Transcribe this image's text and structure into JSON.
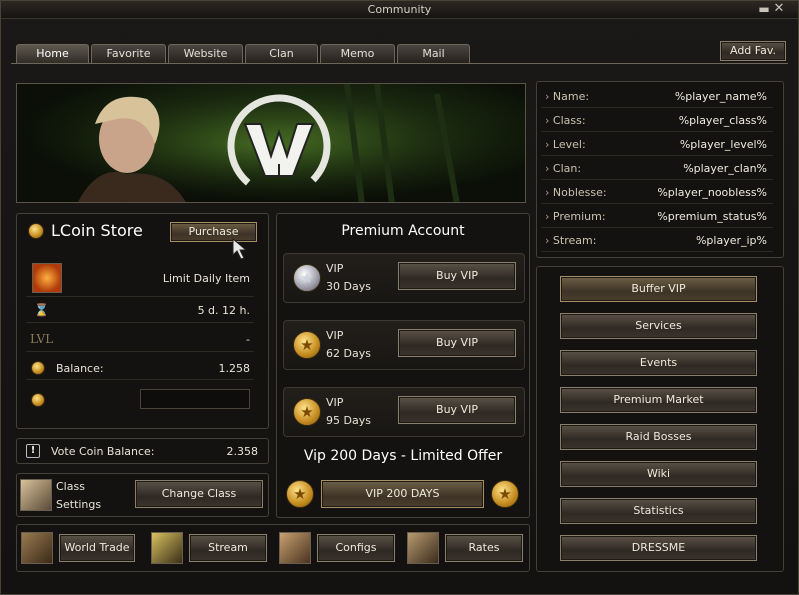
{
  "window": {
    "title": "Community"
  },
  "tabs": [
    "Home",
    "Favorite",
    "Website",
    "Clan",
    "Memo",
    "Mail"
  ],
  "add_fav_label": "Add Fav.",
  "player_info": [
    {
      "label": "Name:",
      "value": "%player_name%"
    },
    {
      "label": "Class:",
      "value": "%player_class%"
    },
    {
      "label": "Level:",
      "value": "%player_level%"
    },
    {
      "label": "Clan:",
      "value": "%player_clan%"
    },
    {
      "label": "Noblesse:",
      "value": "%player_noobless%"
    },
    {
      "label": "Premium:",
      "value": "%premium_status%"
    },
    {
      "label": "Stream:",
      "value": "%player_ip%"
    }
  ],
  "lcoin_store": {
    "title": "LCoin Store",
    "purchase_label": "Purchase",
    "item_name": "Limit Daily Item",
    "time_left": "5 d. 12 h.",
    "level_label": "LVL",
    "level_value": "-",
    "balance_label": "Balance:",
    "balance_value": "1.258",
    "amount_input": ""
  },
  "vote_coin": {
    "label": "Vote Coin Balance:",
    "value": "2.358"
  },
  "class_settings": {
    "label_line1": "Class",
    "label_line2": "Settings",
    "button": "Change Class"
  },
  "premium": {
    "title": "Premium Account",
    "offers": [
      {
        "name": "VIP",
        "duration": "30 Days",
        "button": "Buy VIP"
      },
      {
        "name": "VIP",
        "duration": "62 Days",
        "button": "Buy VIP"
      },
      {
        "name": "VIP",
        "duration": "95 Days",
        "button": "Buy VIP"
      }
    ],
    "limited_title": "Vip 200 Days - Limited Offer",
    "limited_button": "VIP 200 DAYS"
  },
  "side_menu": [
    "Buffer VIP",
    "Services",
    "Events",
    "Premium Market",
    "Raid Bosses",
    "Wiki",
    "Statistics",
    "DRESSME"
  ],
  "bottom_bar": [
    "World Trade",
    "Stream",
    "Configs",
    "Rates"
  ],
  "colors": {
    "gold": "#d9a63a",
    "panel": "#141210",
    "border": "#8a7f6c"
  }
}
